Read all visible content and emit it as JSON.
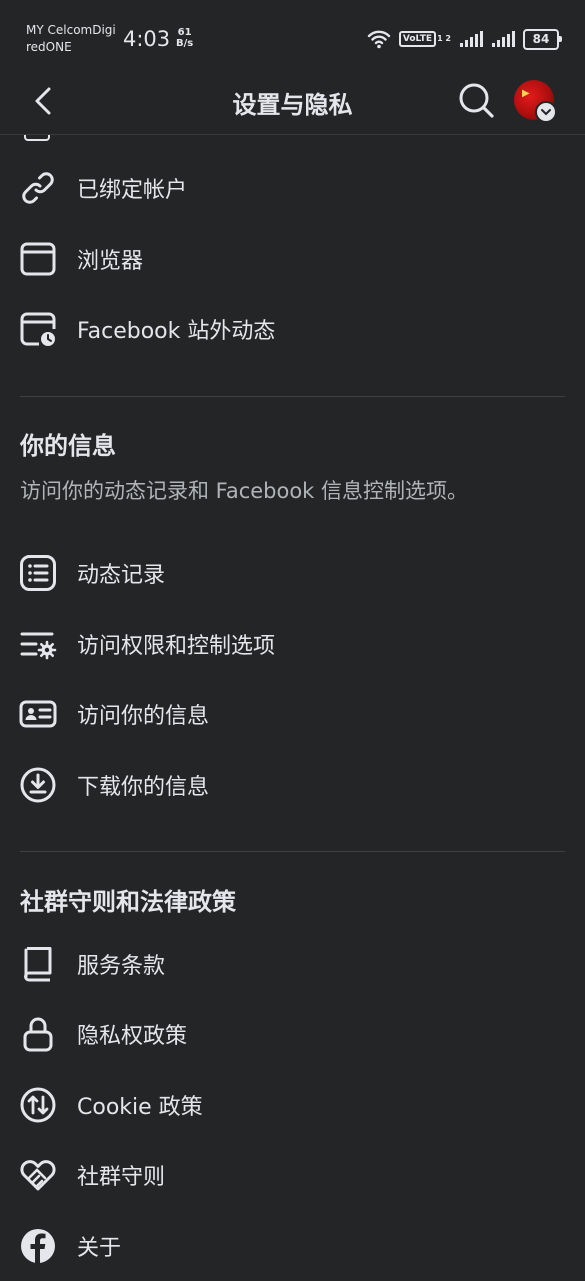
{
  "status_bar": {
    "carrier_line1": "MY CelcomDigi",
    "carrier_line2": "redONE",
    "time": "4:03",
    "speed_value": "61",
    "speed_unit": "B/s",
    "volte": "VoLTE",
    "volte_sub": "1 2",
    "battery": "84"
  },
  "header": {
    "title": "设置与隐私"
  },
  "groups": {
    "permissions": {
      "items": [
        {
          "label": "已绑定帐户",
          "icon": "link-icon"
        },
        {
          "label": "浏览器",
          "icon": "browser-window-icon"
        },
        {
          "label": "Facebook 站外动态",
          "icon": "off-facebook-activity-icon"
        }
      ]
    },
    "your_info": {
      "title": "你的信息",
      "description": "访问你的动态记录和 Facebook 信息控制选项。",
      "items": [
        {
          "label": "动态记录",
          "icon": "activity-log-icon"
        },
        {
          "label": "访问权限和控制选项",
          "icon": "access-controls-icon"
        },
        {
          "label": "访问你的信息",
          "icon": "id-card-icon"
        },
        {
          "label": "下载你的信息",
          "icon": "download-icon"
        }
      ]
    },
    "community": {
      "title": "社群守则和法律政策",
      "items": [
        {
          "label": "服务条款",
          "icon": "book-icon"
        },
        {
          "label": "隐私权政策",
          "icon": "lock-icon"
        },
        {
          "label": "Cookie 政策",
          "icon": "cookie-arrows-icon"
        },
        {
          "label": "社群守则",
          "icon": "heart-handshake-icon"
        },
        {
          "label": "关于",
          "icon": "facebook-logo-icon"
        }
      ]
    }
  }
}
